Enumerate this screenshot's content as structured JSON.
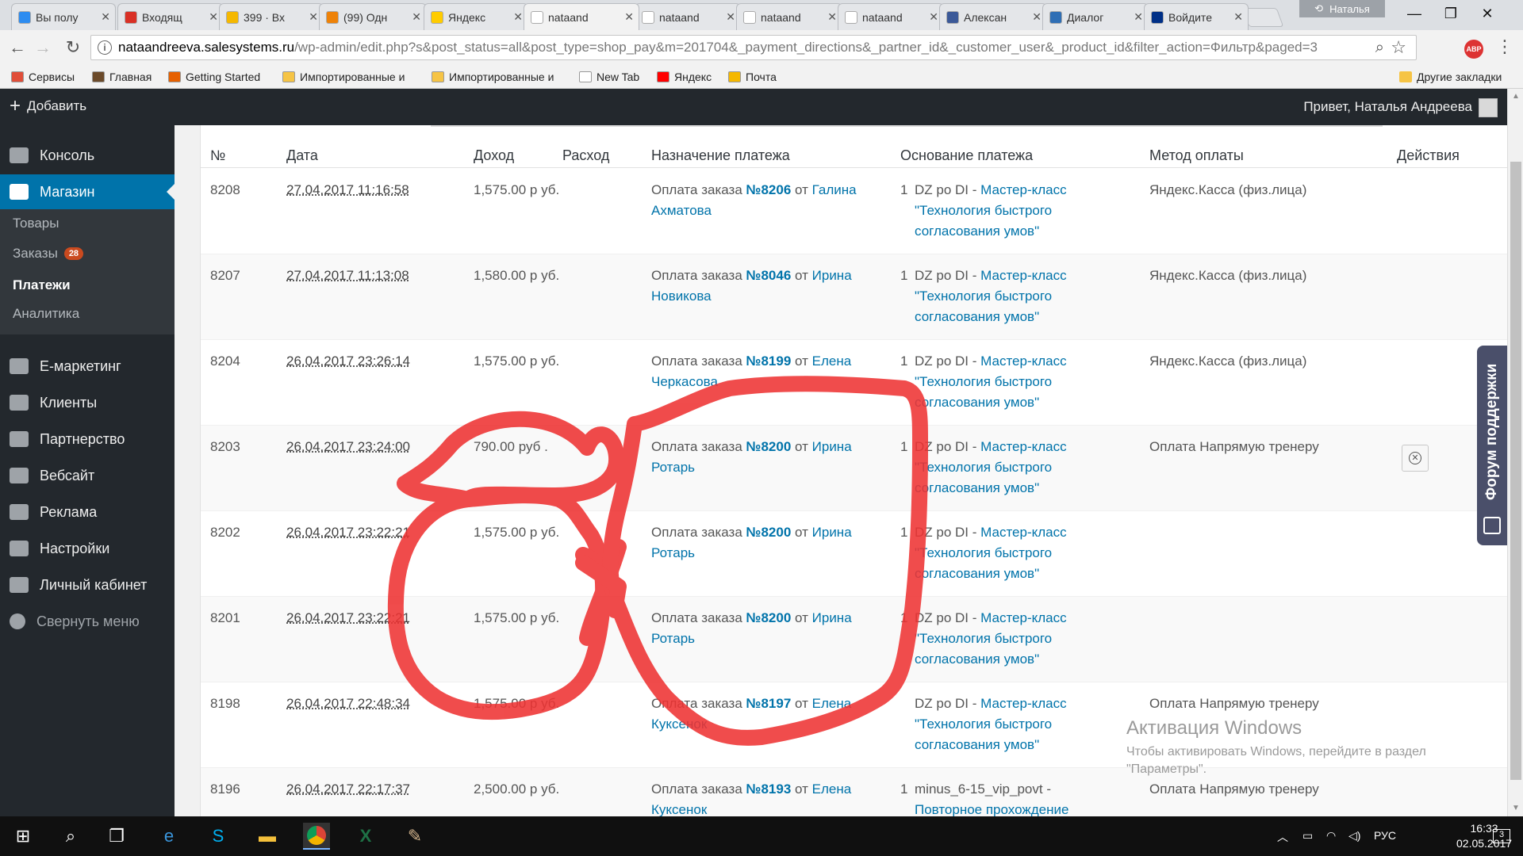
{
  "browser": {
    "tabs": [
      {
        "title": "Вы полу",
        "icon": "mail-icon",
        "color": "#2d8cf0"
      },
      {
        "title": "Входящ",
        "icon": "gmail-icon",
        "color": "#d93025"
      },
      {
        "title": "399 · Вх",
        "icon": "yandex-mail-icon",
        "color": "#f5b800"
      },
      {
        "title": "(99) Одн",
        "icon": "odnoklassniki-icon",
        "color": "#ee8208"
      },
      {
        "title": "Яндекс",
        "icon": "yandex-disk-icon",
        "color": "#ffcc00"
      },
      {
        "title": "nataand",
        "icon": "page-icon",
        "color": "#ffffff"
      },
      {
        "title": "nataand",
        "icon": "page-icon",
        "color": "#ffffff"
      },
      {
        "title": "nataand",
        "icon": "page-icon",
        "color": "#ffffff"
      },
      {
        "title": "nataand",
        "icon": "page-icon",
        "color": "#ffffff"
      },
      {
        "title": "Алексан",
        "icon": "facebook-icon",
        "color": "#3b5998"
      },
      {
        "title": "Диалог",
        "icon": "chat-icon",
        "color": "#2f6fb5"
      },
      {
        "title": "Войдите",
        "icon": "paypal-icon",
        "color": "#003087"
      }
    ],
    "active_tab": 5,
    "profile_name": "Наталья",
    "url_domain": "nataandreeva.salesystems.ru",
    "url_path": "/wp-admin/edit.php?s&post_status=all&post_type=shop_pay&m=201704&_payment_directions&_partner_id&_customer_user&_product_id&filter_action=Фильтр&paged=3",
    "abp_label": "ABP",
    "bookmarks": [
      {
        "label": "Сервисы",
        "icon": "apps-icon",
        "color": "#e04e39"
      },
      {
        "label": "Главная",
        "icon": "site-icon",
        "color": "#6b4a2a"
      },
      {
        "label": "Getting Started",
        "icon": "firefox-icon",
        "color": "#e66000"
      },
      {
        "label": "Импортированные и",
        "icon": "folder-icon",
        "color": "#f6c445"
      },
      {
        "label": "Импортированные и",
        "icon": "folder-icon",
        "color": "#f6c445"
      },
      {
        "label": "New Tab",
        "icon": "page-icon",
        "color": "#ffffff"
      },
      {
        "label": "Яндекс",
        "icon": "yandex-icon",
        "color": "#ff0000"
      },
      {
        "label": "Почта",
        "icon": "mail-icon",
        "color": "#f5b800"
      }
    ],
    "other_bookmarks": "Другие закладки"
  },
  "adminbar": {
    "add_label": "Добавить",
    "greeting": "Привет, Наталья Андреева"
  },
  "sidebar": {
    "items": [
      {
        "label": "Консоль",
        "icon": "dashboard-icon"
      },
      {
        "label": "Магазин",
        "icon": "store-icon"
      },
      {
        "label": "Е-маркетинг",
        "icon": "chart-icon"
      },
      {
        "label": "Клиенты",
        "icon": "users-icon"
      },
      {
        "label": "Партнерство",
        "icon": "partners-icon"
      },
      {
        "label": "Вебсайт",
        "icon": "website-icon"
      },
      {
        "label": "Реклама",
        "icon": "gear-icon"
      },
      {
        "label": "Настройки",
        "icon": "gear-icon"
      },
      {
        "label": "Личный кабинет",
        "icon": "user-icon"
      },
      {
        "label": "Свернуть меню",
        "icon": "collapse-icon"
      }
    ],
    "submenu": [
      {
        "label": "Товары"
      },
      {
        "label": "Заказы",
        "badge": "28"
      },
      {
        "label": "Платежи"
      },
      {
        "label": "Аналитика"
      }
    ]
  },
  "table": {
    "headers": [
      "№",
      "Дата",
      "Доход",
      "Расход",
      "Назначение платежа",
      "Основание платежа",
      "Метод оплаты",
      "Действия"
    ],
    "rows": [
      {
        "num": "8208",
        "date": "27.04.2017 11:16:58",
        "income": "1,575.00 р уб.",
        "purpose_prefix": "Оплата заказа",
        "order": "№8206",
        "from": "от",
        "customer": "Галина Ахматова",
        "qty": "1",
        "basis_prefix": "DZ po DI -",
        "basis_link": "Мастер-класс \"Технология быстрого согласования умов\"",
        "method": "Яндекс.Касса (физ.лица)",
        "action": false
      },
      {
        "num": "8207",
        "date": "27.04.2017 11:13:08",
        "income": "1,580.00 р уб.",
        "purpose_prefix": "Оплата заказа",
        "order": "№8046",
        "from": "от",
        "customer": "Ирина Новикова",
        "qty": "1",
        "basis_prefix": "DZ po DI -",
        "basis_link": "Мастер-класс \"Технология быстрого согласования умов\"",
        "method": "Яндекс.Касса (физ.лица)",
        "action": false
      },
      {
        "num": "8204",
        "date": "26.04.2017 23:26:14",
        "income": "1,575.00 р уб.",
        "purpose_prefix": "Оплата заказа",
        "order": "№8199",
        "from": "от",
        "customer": "Елена Черкасова",
        "qty": "1",
        "basis_prefix": "DZ po DI -",
        "basis_link": "Мастер-класс \"Технология быстрого согласования умов\"",
        "method": "Яндекс.Касса (физ.лица)",
        "action": false
      },
      {
        "num": "8203",
        "date": "26.04.2017 23:24:00",
        "income": "790.00 руб .",
        "purpose_prefix": "Оплата заказа",
        "order": "№8200",
        "from": "от",
        "customer": "Ирина Ротарь",
        "qty": "1",
        "basis_prefix": "DZ po DI -",
        "basis_link": "Мастер-класс \"Технология быстрого согласования умов\"",
        "method": "Оплата Напрямую тренеру",
        "action": true
      },
      {
        "num": "8202",
        "date": "26.04.2017 23:22:21",
        "income": "1,575.00 р уб.",
        "purpose_prefix": "Оплата заказа",
        "order": "№8200",
        "from": "от",
        "customer": "Ирина Ротарь",
        "qty": "1",
        "basis_prefix": "DZ po DI -",
        "basis_link": "Мастер-класс \"Технология быстрого согласования умов\"",
        "method": "",
        "action": false
      },
      {
        "num": "8201",
        "date": "26.04.2017 23:22:21",
        "income": "1,575.00 р уб.",
        "purpose_prefix": "Оплата заказа",
        "order": "№8200",
        "from": "от",
        "customer": "Ирина Ротарь",
        "qty": "1",
        "basis_prefix": "DZ po DI -",
        "basis_link": "Мастер-класс \"Технология быстрого согласования умов\"",
        "method": "",
        "action": false
      },
      {
        "num": "8198",
        "date": "26.04.2017 22:48:34",
        "income": "1,575.00 р уб.",
        "purpose_prefix": "Оплата заказа",
        "order": "№8197",
        "from": "от",
        "customer": "Елена Куксенок",
        "qty": "",
        "basis_prefix": "DZ po DI -",
        "basis_link": "Мастер-класс \"Технология быстрого согласования умов\"",
        "method": "Оплата Напрямую тренеру",
        "action": false
      },
      {
        "num": "8196",
        "date": "26.04.2017 22:17:37",
        "income": "2,500.00 р уб.",
        "purpose_prefix": "Оплата заказа",
        "order": "№8193",
        "from": "от",
        "customer": "Елена Куксенок",
        "qty": "1",
        "basis_prefix": "minus_6-15_vip_povt -",
        "basis_link": "Повторное прохождение",
        "method": "Оплата Напрямую тренеру",
        "action": false
      }
    ]
  },
  "support_tab": "Форум поддержки",
  "watermark": {
    "title": "Активация Windows",
    "text": "Чтобы активировать Windows, перейдите в раздел \"Параметры\"."
  },
  "taskbar": {
    "lang": "РУС",
    "time": "16:33",
    "date": "02.05.2017",
    "notifications": "3"
  },
  "annotation_color": "#ee3333"
}
